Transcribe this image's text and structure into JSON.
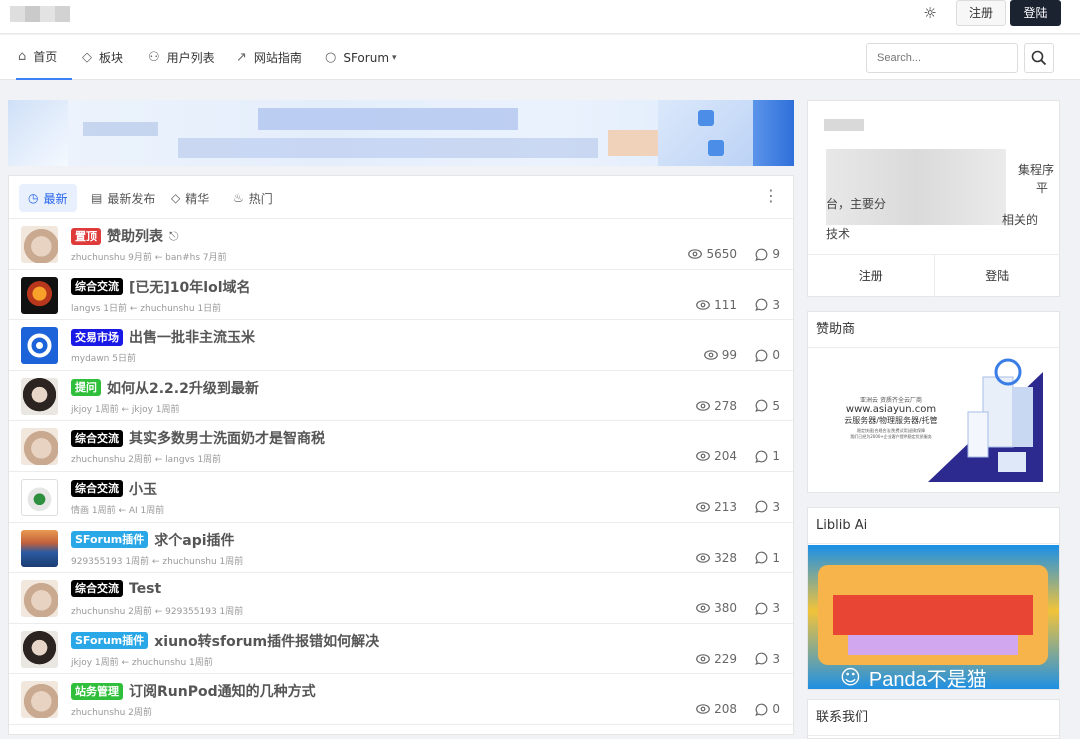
{
  "header": {
    "theme_toggle_icon": "sun-icon",
    "register_label": "注册",
    "login_label": "登陆"
  },
  "nav": {
    "items": [
      {
        "label": "首页",
        "icon": "home-icon"
      },
      {
        "label": "板块",
        "icon": "tag-icon"
      },
      {
        "label": "用户列表",
        "icon": "users-icon"
      },
      {
        "label": "网站指南",
        "icon": "route-icon"
      },
      {
        "label": "SForum",
        "icon": "chat-icon"
      }
    ],
    "search_placeholder": "Search..."
  },
  "tabs": [
    "最新",
    "最新发布",
    "精华",
    "热门"
  ],
  "badge_colors": {
    "置顶": "#e03b3b",
    "综合交流": "#000000",
    "交易市场": "#1a1ae6",
    "提问": "#2fbf3a",
    "SForum插件": "#29a7e6",
    "站务管理": "#2fbf3a"
  },
  "topics": [
    {
      "badge": "置顶",
      "title": "赞助列表",
      "locked": true,
      "meta": "zhuchunshu 9月前 ← ban#hs 7月前",
      "views": "5650",
      "comments": "9",
      "avatar": "cat"
    },
    {
      "badge": "综合交流",
      "title": "[已无]10年lol域名",
      "locked": false,
      "meta": "langvs 1日前 ← zhuchunshu 1日前",
      "views": "111",
      "comments": "3",
      "avatar": "fire"
    },
    {
      "badge": "交易市场",
      "title": "出售一批非主流玉米",
      "locked": false,
      "meta": "mydawn 5日前",
      "views": "99",
      "comments": "0",
      "avatar": "blue"
    },
    {
      "badge": "提问",
      "title": "如何从2.2.2升级到最新",
      "locked": false,
      "meta": "jkjoy 1周前 ← jkjoy 1周前",
      "views": "278",
      "comments": "5",
      "avatar": "girl"
    },
    {
      "badge": "综合交流",
      "title": "其实多数男士洗面奶才是智商税",
      "locked": false,
      "meta": "zhuchunshu 2周前 ← langvs 1周前",
      "views": "204",
      "comments": "1",
      "avatar": "cat"
    },
    {
      "badge": "综合交流",
      "title": "小玉",
      "locked": false,
      "meta": "情画 1周前 ← AI 1周前",
      "views": "213",
      "comments": "3",
      "avatar": "duck"
    },
    {
      "badge": "SForum插件",
      "title": "求个api插件",
      "locked": false,
      "meta": "929355193 1周前 ← zhuchunshu 1周前",
      "views": "328",
      "comments": "1",
      "avatar": "sea"
    },
    {
      "badge": "综合交流",
      "title": "Test",
      "locked": false,
      "meta": "zhuchunshu 2周前 ← 929355193 1周前",
      "views": "380",
      "comments": "3",
      "avatar": "cat"
    },
    {
      "badge": "SForum插件",
      "title": "xiuno转sforum插件报错如何解决",
      "locked": false,
      "meta": "jkjoy 1周前 ← zhuchunshu 1周前",
      "views": "229",
      "comments": "3",
      "avatar": "girl"
    },
    {
      "badge": "站务管理",
      "title": "订阅RunPod通知的几种方式",
      "locked": false,
      "meta": "zhuchunshu 2周前",
      "views": "208",
      "comments": "0",
      "avatar": "cat"
    }
  ],
  "sidebar": {
    "intro": {
      "line1": "集程序",
      "line2": "平",
      "line3": "台，主要分",
      "line4": "相关的",
      "line5": "技术",
      "register": "注册",
      "login": "登陆"
    },
    "sponsor": {
      "title": "赞助商",
      "ad_line1": "亚洲云 资质齐全云厂商",
      "ad_line2": "www.asiayun.com",
      "ad_line3": "云服务器/物理服务器/托管",
      "ad_line4": "稳定快速|合规合法|免费试用|退款保障",
      "ad_line5": "我们已经为2000+企业客户提供稳定优质服务"
    },
    "liblib": {
      "title": "Liblib Ai"
    },
    "watermark": "Panda不是猫",
    "contact": {
      "title": "联系我们"
    }
  }
}
